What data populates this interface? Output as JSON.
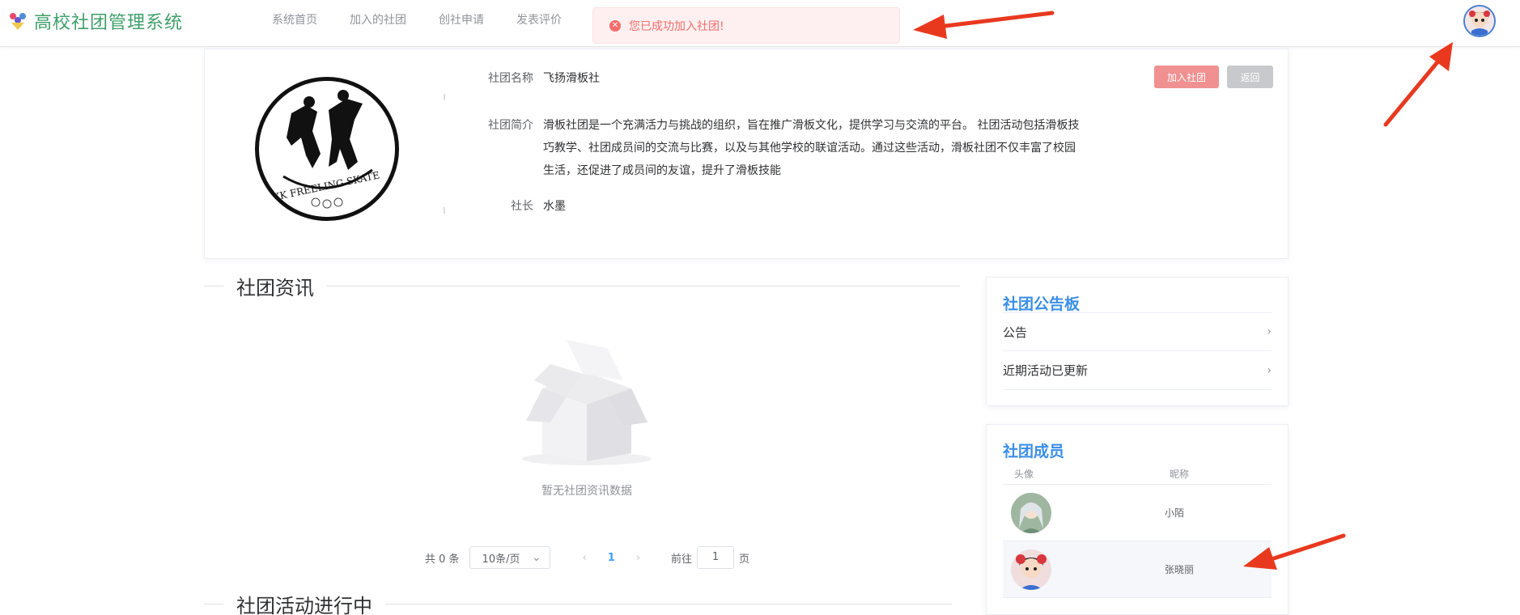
{
  "header": {
    "title": "高校社团管理系统",
    "nav": [
      "系统首页",
      "加入的社团",
      "创社申请",
      "发表评价"
    ]
  },
  "toast": {
    "icon": "close-circle-icon",
    "message": "您已成功加入社团!"
  },
  "club": {
    "logo_text": "XK FREELING SKATE",
    "name_label": "社团名称",
    "name": "飞扬滑板社",
    "intro_label": "社团简介",
    "intro_lines": [
      "滑板社团是一个充满活力与挑战的组织，旨在推广滑板文化，提供学习与交流的平台。 社团活动包括滑板技",
      "巧教学、社团成员间的交流与比赛，以及与其他学校的联谊活动。通过这些活动，滑板社团不仅丰富了校园",
      "生活，还促进了成员间的友谊，提升了滑板技能"
    ],
    "leader_label": "社长",
    "leader": "水墨",
    "join_button": "加入社团",
    "back_button": "返回"
  },
  "news": {
    "title": "社团资讯",
    "empty_text": "暂无社团资讯数据"
  },
  "pagination": {
    "total": "共 0 条",
    "page_size": "10条/页",
    "current_page": "1",
    "goto_label": "前往",
    "goto_value": "1",
    "page_unit": "页"
  },
  "activities": {
    "title": "社团活动进行中"
  },
  "notice_board": {
    "title": "社团公告板",
    "items": [
      "公告",
      "近期活动已更新"
    ]
  },
  "members": {
    "title": "社团成员",
    "columns": [
      "头像",
      "昵称"
    ],
    "rows": [
      {
        "nickname": "小陌"
      },
      {
        "nickname": "张晓丽"
      }
    ]
  },
  "colors": {
    "brand": "#3f9f6a",
    "accent": "#3a8ee6",
    "danger": "#f56c6c",
    "annotation_arrow": "#e8391f"
  }
}
